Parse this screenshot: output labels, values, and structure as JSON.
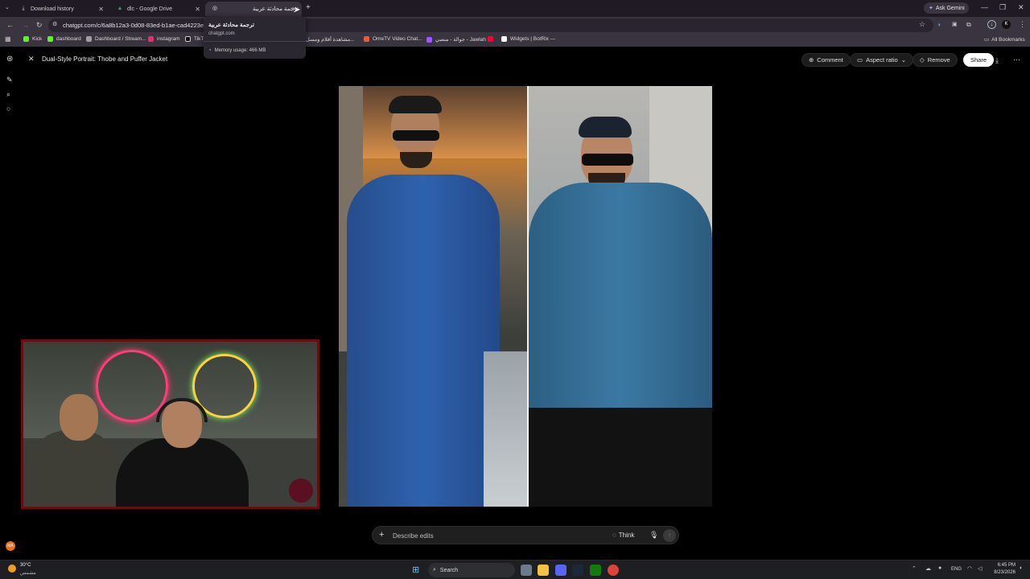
{
  "tabs": [
    {
      "label": "Download history"
    },
    {
      "label": "dlc - Google Drive"
    },
    {
      "label": "ترجمة محادثة عربية"
    }
  ],
  "ask_gemini": "Ask Gemini",
  "url": "chatgpt.com/c/6a8b12a3-0d08-83ed-b1ae-cad4223e73",
  "tooltip": {
    "title": "ترجمة محادثة عربية",
    "site": "chatgpt.com",
    "memory": "Memory usage: 466 MB"
  },
  "bookmarks": [
    {
      "label": "Kick",
      "color": "#53fc18"
    },
    {
      "label": "dashboard",
      "color": "#53fc18"
    },
    {
      "label": "Dashboard / Stream...",
      "color": "#9aa0a6"
    },
    {
      "label": "instagram",
      "color": "#e1306c"
    },
    {
      "label": "TikTo",
      "color": "#eeeeee"
    },
    {
      "label": "مشاهدة أفلام ومسل...",
      "color": "#cccccc"
    },
    {
      "label": "OmeTV Video Chat...",
      "color": "#e65c3b"
    },
    {
      "label": "جوالة - منصي - Jawlah ...",
      "color": "#9b59ff"
    },
    {
      "label": "",
      "color": "#ff0033"
    },
    {
      "label": "Widgets | BotRix ---",
      "color": "#ffffff"
    }
  ],
  "all_bookmarks": "All Bookmarks",
  "editor": {
    "title": "Dual-Style Portrait: Thobe and Puffer Jacket",
    "comment": "Comment",
    "aspect_ratio": "Aspect ratio",
    "remove": "Remove",
    "share": "Share"
  },
  "composer": {
    "placeholder": "Describe edits",
    "think": "Think"
  },
  "taskbar": {
    "weather_temp": "30°C",
    "weather_desc": "مشمس",
    "search": "Search",
    "lang": "ENG",
    "time": "6:45 PM",
    "date": "8/23/2026"
  },
  "colors": {
    "tab_bar": "#1f1a24",
    "toolbar": "#3a3340",
    "share_button": "#ffffff",
    "webcam_border": "#6a0c14"
  }
}
